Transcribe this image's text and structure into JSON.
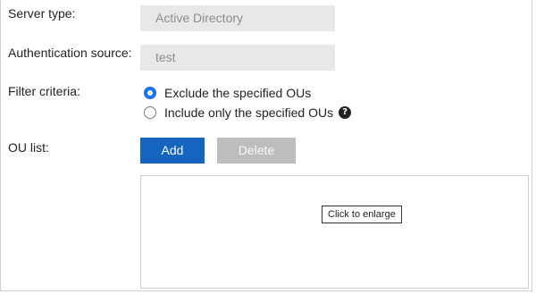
{
  "form": {
    "server_type": {
      "label": "Server type:",
      "value": "Active Directory"
    },
    "auth_source": {
      "label": "Authentication source:",
      "value": "test"
    },
    "filter": {
      "label": "Filter criteria:",
      "options": [
        {
          "label": "Exclude the specified OUs",
          "checked": true
        },
        {
          "label": "Include only the specified OUs",
          "checked": false
        }
      ],
      "help_glyph": "?"
    },
    "ou_list": {
      "label": "OU list:",
      "add_label": "Add",
      "delete_label": "Delete",
      "enlarge_hint": "Click to enlarge"
    }
  },
  "colors": {
    "accent": "#1565c0",
    "radio_checked": "#1a73e8",
    "disabled_button": "#bdbdbd",
    "readonly_bg": "#e8e8e8"
  },
  "icons": [
    "help-circle-icon"
  ]
}
